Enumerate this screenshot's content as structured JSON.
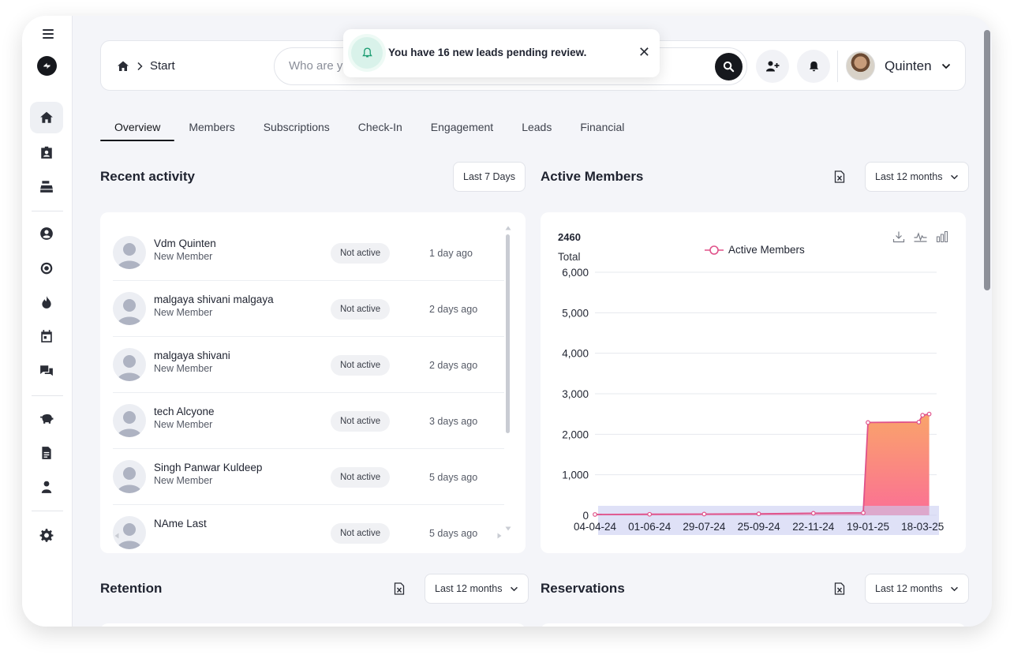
{
  "topbar": {
    "breadcrumb": "Start",
    "search_placeholder": "Who are you looking for?",
    "user_name": "Quinten"
  },
  "toast": {
    "message": "You have 16 new leads pending review."
  },
  "tabs": [
    "Overview",
    "Members",
    "Subscriptions",
    "Check-In",
    "Engagement",
    "Leads",
    "Financial"
  ],
  "recent_activity": {
    "title": "Recent activity",
    "range": "Last 7 Days",
    "items": [
      {
        "name": "Vdm Quinten",
        "role": "New Member",
        "status": "Not active",
        "when": "1 day ago"
      },
      {
        "name": "malgaya shivani malgaya",
        "role": "New Member",
        "status": "Not active",
        "when": "2 days ago"
      },
      {
        "name": "malgaya shivani",
        "role": "New Member",
        "status": "Not active",
        "when": "2 days ago"
      },
      {
        "name": "tech Alcyone",
        "role": "New Member",
        "status": "Not active",
        "when": "3 days ago"
      },
      {
        "name": "Singh Panwar Kuldeep",
        "role": "New Member",
        "status": "Not active",
        "when": "5 days ago"
      },
      {
        "name": "NAme Last",
        "role": "",
        "status": "Not active",
        "when": "5 days ago"
      }
    ]
  },
  "active_members": {
    "title": "Active Members",
    "range": "Last 12 months",
    "total_value": "2460",
    "total_label": "Total",
    "colors": {
      "line": "#e0528a",
      "area_top": "#f9a46a",
      "area_bottom": "#fb6f95"
    }
  },
  "chart_data": {
    "type": "area",
    "x": [
      "04-04-24",
      "01-06-24",
      "29-07-24",
      "25-09-24",
      "22-11-24",
      "19-01-25",
      "18-03-25"
    ],
    "series": [
      {
        "name": "Active Members",
        "points": [
          {
            "x": "04-04-24",
            "y": 20
          },
          {
            "x": "01-06-24",
            "y": 25
          },
          {
            "x": "29-07-24",
            "y": 30
          },
          {
            "x": "25-09-24",
            "y": 35
          },
          {
            "x": "22-11-24",
            "y": 50
          },
          {
            "x": "14-01-25",
            "y": 60
          },
          {
            "x": "19-01-25",
            "y": 2290
          },
          {
            "x": "14-03-25",
            "y": 2300
          },
          {
            "x": "18-03-25",
            "y": 2470
          },
          {
            "x": "25-03-25",
            "y": 2500
          }
        ]
      }
    ],
    "ylim": [
      0,
      6000
    ],
    "yticks": [
      "0",
      "1,000",
      "2,000",
      "3,000",
      "4,000",
      "5,000",
      "6,000"
    ],
    "grid": true,
    "legend": "top-center"
  },
  "retention": {
    "title": "Retention",
    "range": "Last 12 months"
  },
  "reservations": {
    "title": "Reservations",
    "range": "Last 12 months"
  }
}
